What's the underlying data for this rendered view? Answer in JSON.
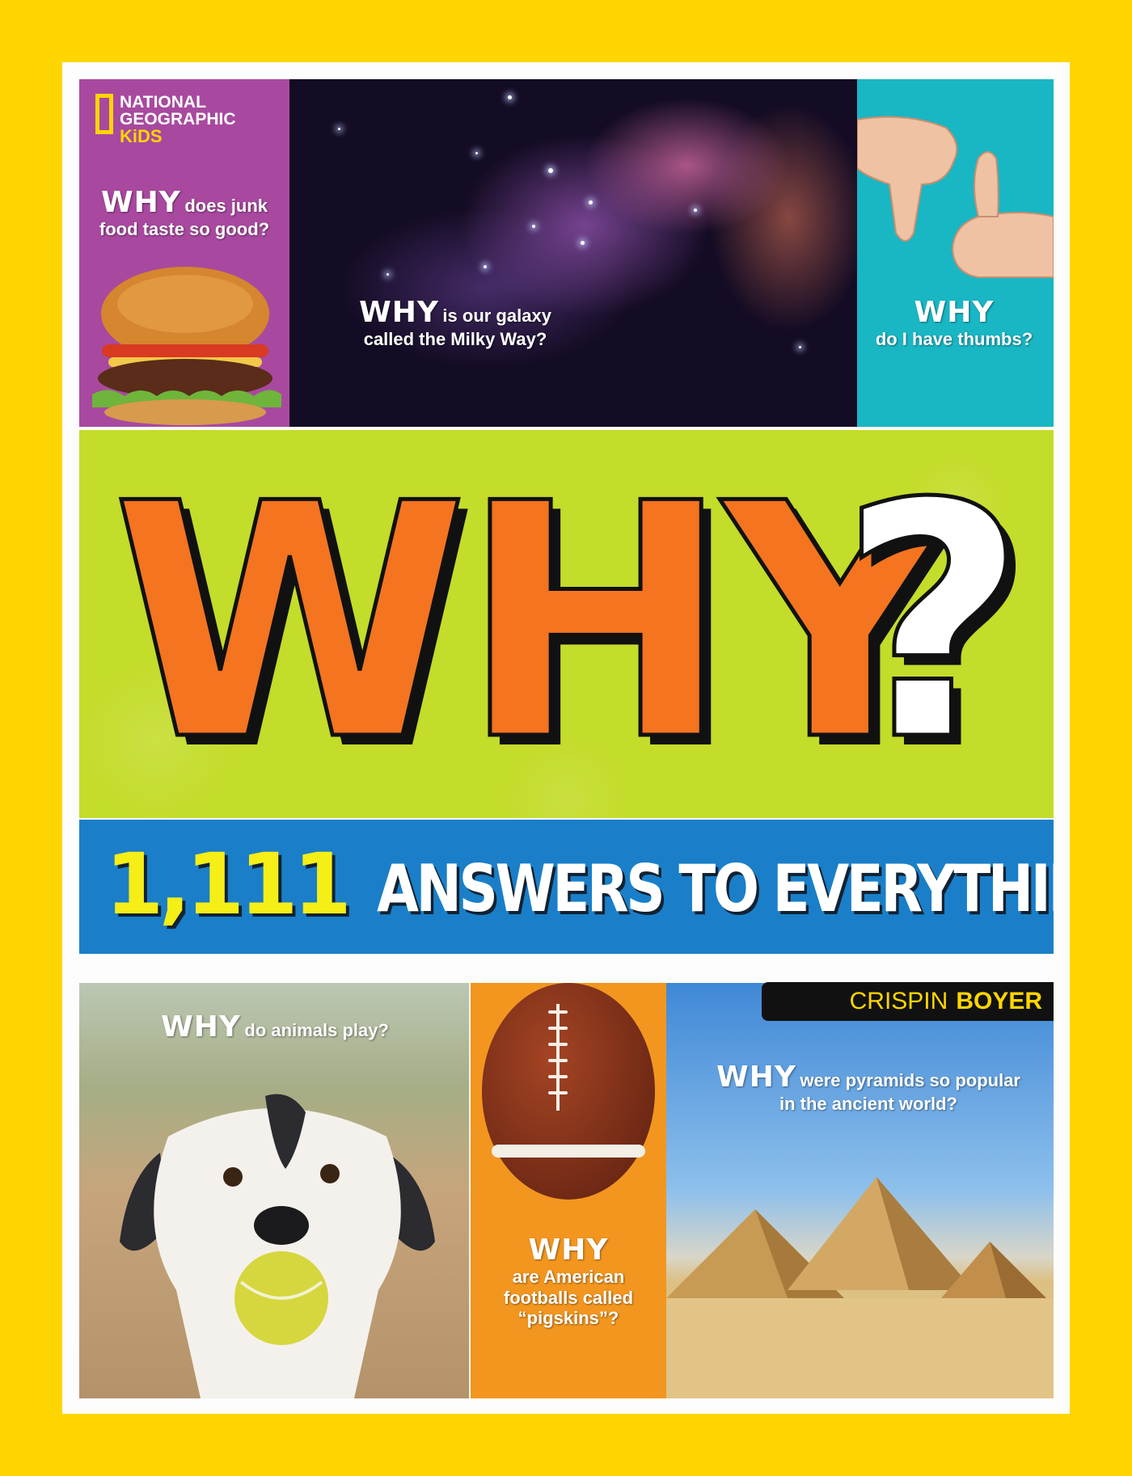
{
  "brand": {
    "line1": "NATIONAL",
    "line2": "GEOGRAPHIC",
    "line3": "KiDS"
  },
  "title": {
    "main": "WHY",
    "mark": "?"
  },
  "subtitle": {
    "number": "1,111",
    "text": "ANSWERS TO EVERYTHING"
  },
  "author": {
    "first": "CRISPIN",
    "last": "BOYER"
  },
  "questions": {
    "junk_food": {
      "why": "WHY",
      "rest": "does junk food taste so good?"
    },
    "galaxy": {
      "why": "WHY",
      "rest": "is our galaxy called the Milky Way?"
    },
    "thumbs": {
      "why": "WHY",
      "rest": "do I have thumbs?"
    },
    "animals": {
      "why": "WHY",
      "rest": "do animals play?"
    },
    "footballs": {
      "why": "WHY",
      "rest": "are American footballs called “pigskins”?"
    },
    "pyramids": {
      "why": "WHY",
      "rest": "were pyramids so popular in the ancient world?"
    }
  },
  "colors": {
    "border_yellow": "#ffd500",
    "purple": "#a8499f",
    "cyan": "#19b6c4",
    "lime": "#c4dc2a",
    "why_orange": "#f47420",
    "blue": "#1a7fc8",
    "subtitle_yellow": "#f5ee17",
    "football_orange": "#f2961f"
  }
}
